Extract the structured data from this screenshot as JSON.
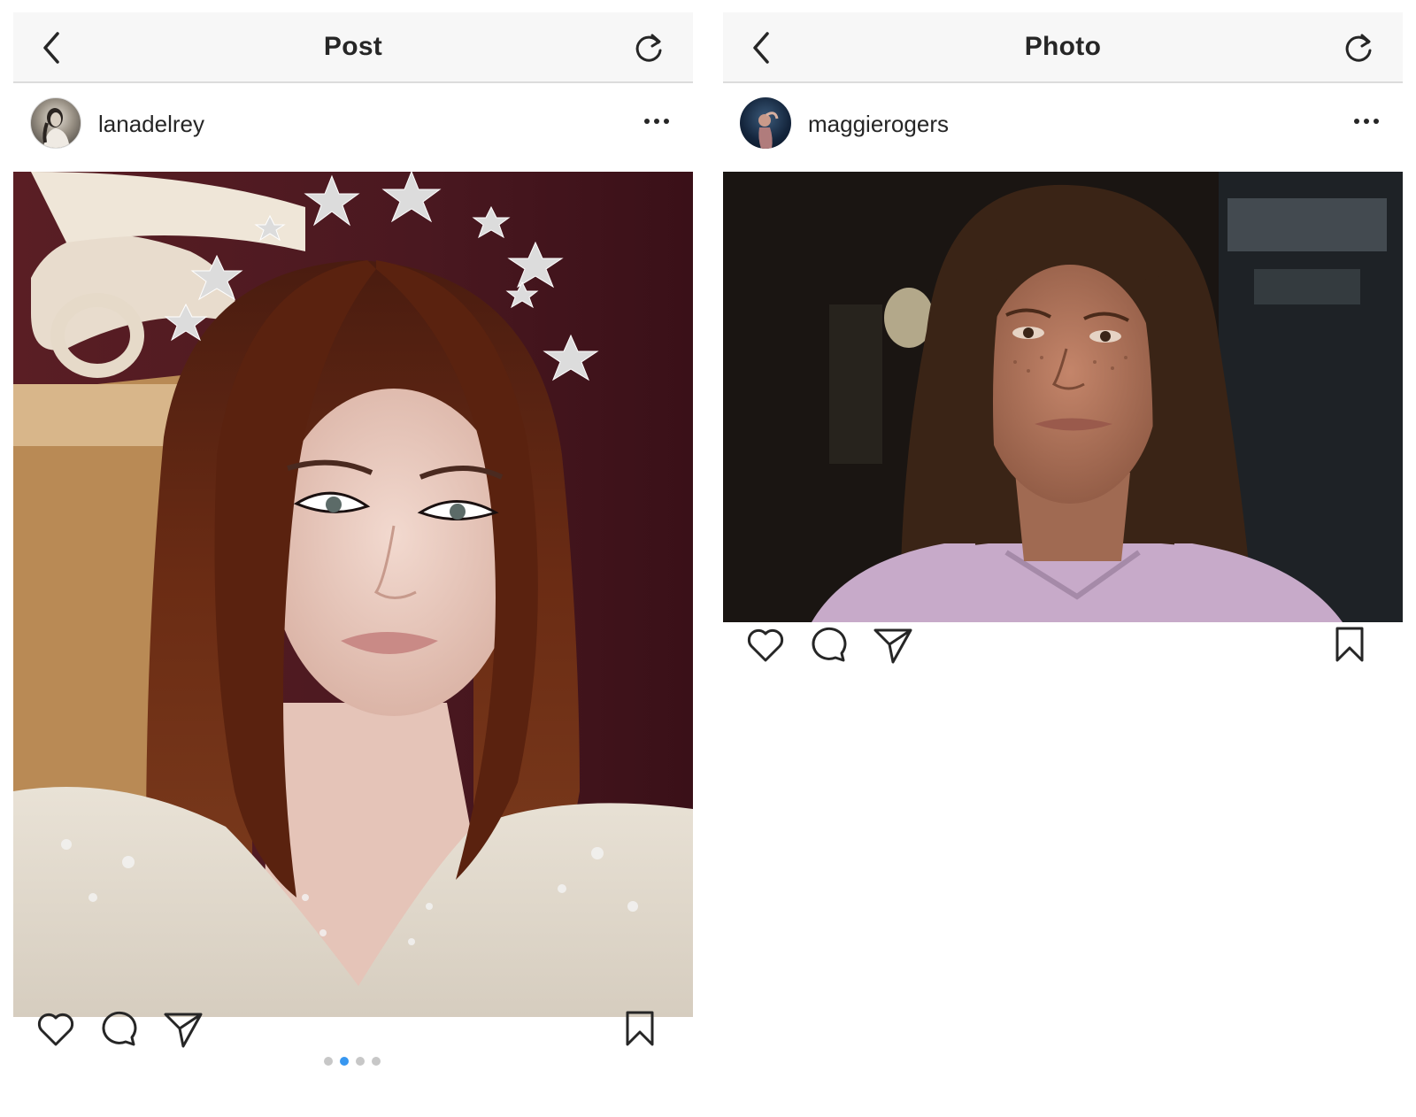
{
  "left_screen": {
    "nav": {
      "title": "Post"
    },
    "post": {
      "username": "lanadelrey"
    },
    "carousel": {
      "total": 4,
      "active_index": 1
    }
  },
  "right_screen": {
    "nav": {
      "title": "Photo"
    },
    "post": {
      "username": "maggierogers"
    }
  },
  "icons": {
    "back": "chevron-left-icon",
    "refresh": "refresh-icon",
    "more": "more-horizontal-icon",
    "like": "heart-icon",
    "comment": "comment-icon",
    "share": "send-icon",
    "save": "bookmark-icon"
  },
  "colors": {
    "navbar_bg": "#f7f7f7",
    "text": "#262626",
    "carousel_active": "#3897f0",
    "carousel_inactive": "#c7c7c7"
  }
}
